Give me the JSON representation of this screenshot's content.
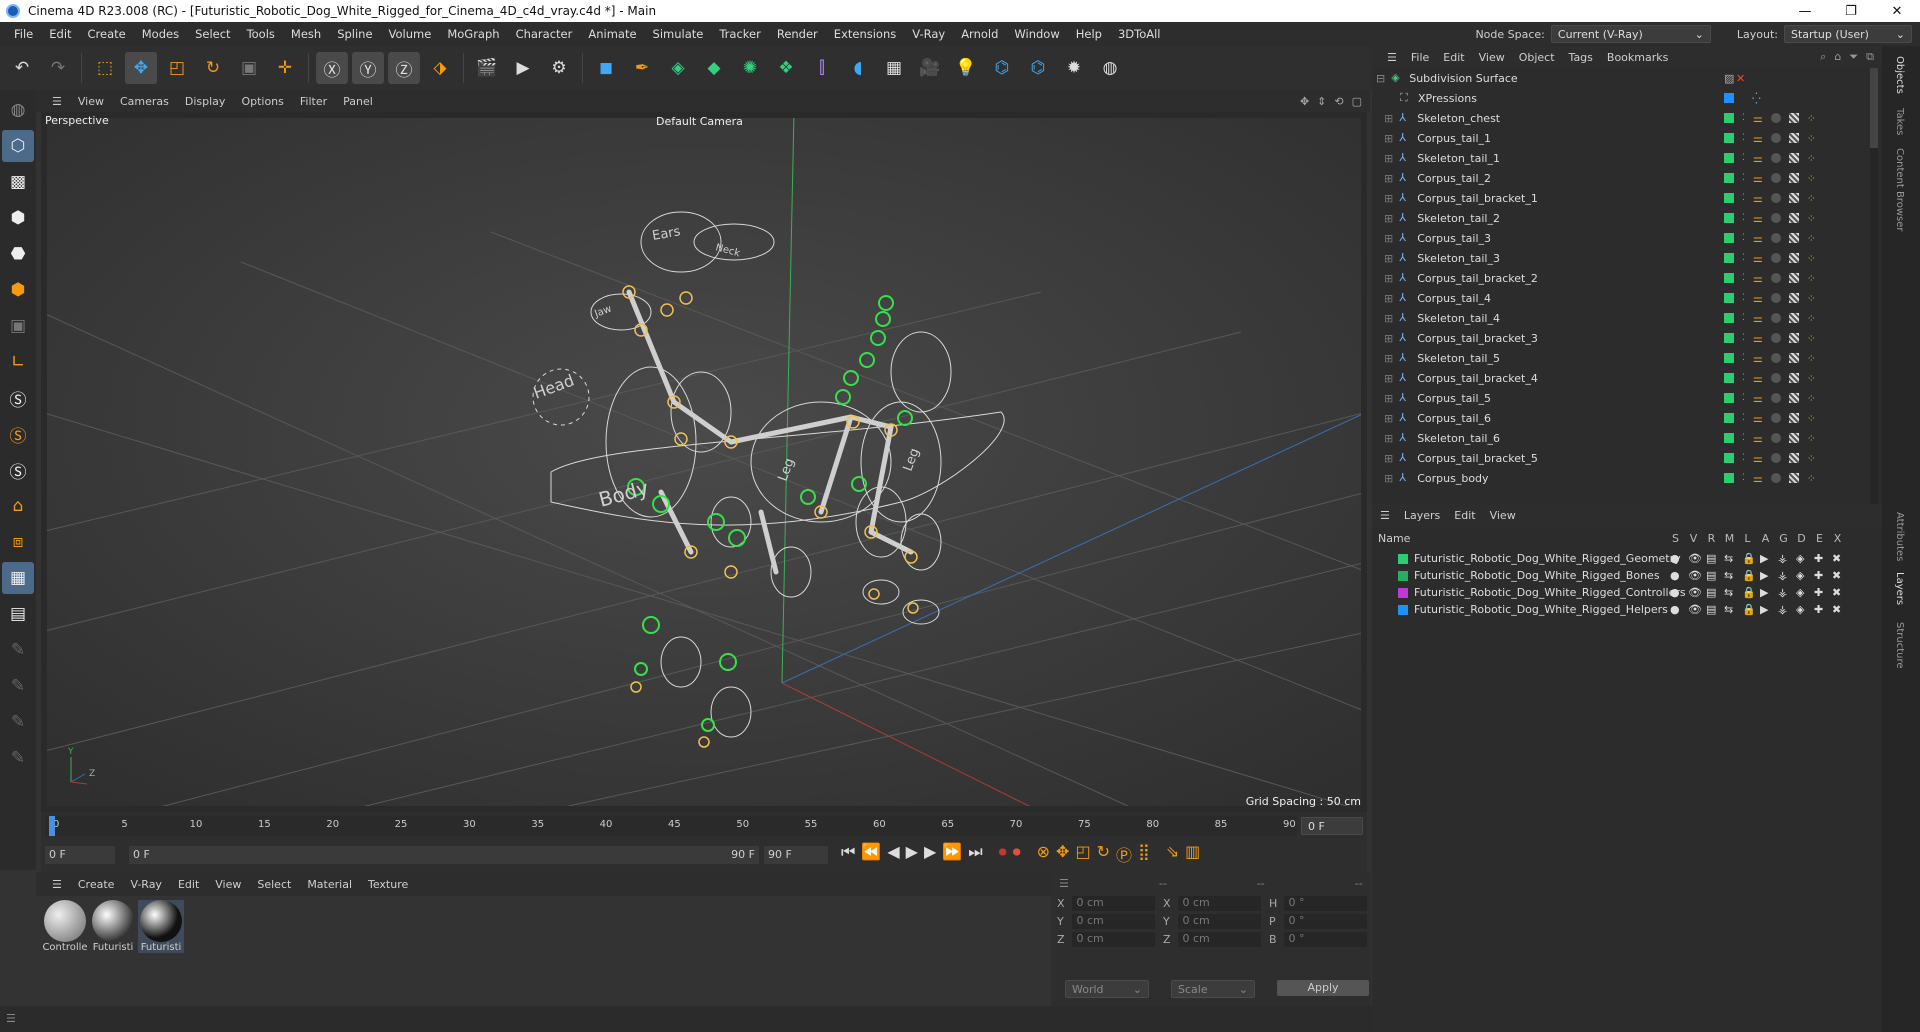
{
  "window": {
    "title": "Cinema 4D R23.008 (RC) - [Futuristic_Robotic_Dog_White_Rigged_for_Cinema_4D_c4d_vray.c4d *] - Main",
    "buttons": [
      "—",
      "❐",
      "✕"
    ]
  },
  "menu": {
    "items": [
      "File",
      "Edit",
      "Create",
      "Modes",
      "Select",
      "Tools",
      "Mesh",
      "Spline",
      "Volume",
      "MoGraph",
      "Character",
      "Animate",
      "Simulate",
      "Tracker",
      "Render",
      "Extensions",
      "V-Ray",
      "Arnold",
      "Window",
      "Help",
      "3DToAll"
    ],
    "node_space_label": "Node Space:",
    "node_space_value": "Current (V-Ray)",
    "layout_label": "Layout:",
    "layout_value": "Startup (User)"
  },
  "viewport": {
    "menu": [
      "View",
      "Cameras",
      "Display",
      "Options",
      "Filter",
      "Panel"
    ],
    "view_name": "Perspective",
    "camera": "Default Camera",
    "grid_spacing": "Grid Spacing : 50 cm",
    "labels": [
      "Ears",
      "Neck",
      "Head",
      "Leg",
      "Leg",
      "Jaw",
      "Body"
    ]
  },
  "timeline": {
    "ticks": [
      "0",
      "5",
      "10",
      "15",
      "20",
      "25",
      "30",
      "35",
      "40",
      "45",
      "50",
      "55",
      "60",
      "65",
      "70",
      "75",
      "80",
      "85",
      "90"
    ],
    "current": "0 F",
    "start": "0 F",
    "range_start": "0 F",
    "range_end": "90 F",
    "end": "90 F"
  },
  "material": {
    "menu": [
      "Create",
      "V-Ray",
      "Edit",
      "View",
      "Select",
      "Material",
      "Texture"
    ],
    "items": [
      "Controlle",
      "Futuristi",
      "Futuristi"
    ]
  },
  "coords": {
    "headers": [
      "--",
      "--",
      "--"
    ],
    "rows": [
      {
        "a": "X",
        "av": "0 cm",
        "b": "X",
        "bv": "0 cm",
        "c": "H",
        "cv": "0 °"
      },
      {
        "a": "Y",
        "av": "0 cm",
        "b": "Y",
        "bv": "0 cm",
        "c": "P",
        "cv": "0 °"
      },
      {
        "a": "Z",
        "av": "0 cm",
        "b": "Z",
        "bv": "0 cm",
        "c": "B",
        "cv": "0 °"
      }
    ],
    "world": "World",
    "scale": "Scale",
    "apply": "Apply"
  },
  "objects": {
    "menu": [
      "File",
      "Edit",
      "View",
      "Object",
      "Tags",
      "Bookmarks"
    ],
    "top": "Subdivision Surface",
    "xpressions": "XPressions",
    "items": [
      "Skeleton_chest",
      "Corpus_tail_1",
      "Skeleton_tail_1",
      "Corpus_tail_2",
      "Corpus_tail_bracket_1",
      "Skeleton_tail_2",
      "Corpus_tail_3",
      "Skeleton_tail_3",
      "Corpus_tail_bracket_2",
      "Corpus_tail_4",
      "Skeleton_tail_4",
      "Corpus_tail_bracket_3",
      "Skeleton_tail_5",
      "Corpus_tail_bracket_4",
      "Corpus_tail_5",
      "Corpus_tail_6",
      "Skeleton_tail_6",
      "Corpus_tail_bracket_5",
      "Corpus_body"
    ]
  },
  "layers": {
    "menu": [
      "Layers",
      "Edit",
      "View"
    ],
    "header": {
      "name": "Name",
      "cols": [
        "S",
        "V",
        "R",
        "M",
        "L",
        "A",
        "G",
        "D",
        "E",
        "X"
      ]
    },
    "items": [
      {
        "name": "Futuristic_Robotic_Dog_White_Rigged_Geometry",
        "color": "#2ecc71"
      },
      {
        "name": "Futuristic_Robotic_Dog_White_Rigged_Bones",
        "color": "#27ae60"
      },
      {
        "name": "Futuristic_Robotic_Dog_White_Rigged_Controllers",
        "color": "#c039d6"
      },
      {
        "name": "Futuristic_Robotic_Dog_White_Rigged_Helpers",
        "color": "#1e90ff"
      }
    ]
  },
  "right_tabs": [
    "Objects",
    "Takes",
    "Content Browser",
    "Attributes",
    "Layers",
    "Structure"
  ]
}
